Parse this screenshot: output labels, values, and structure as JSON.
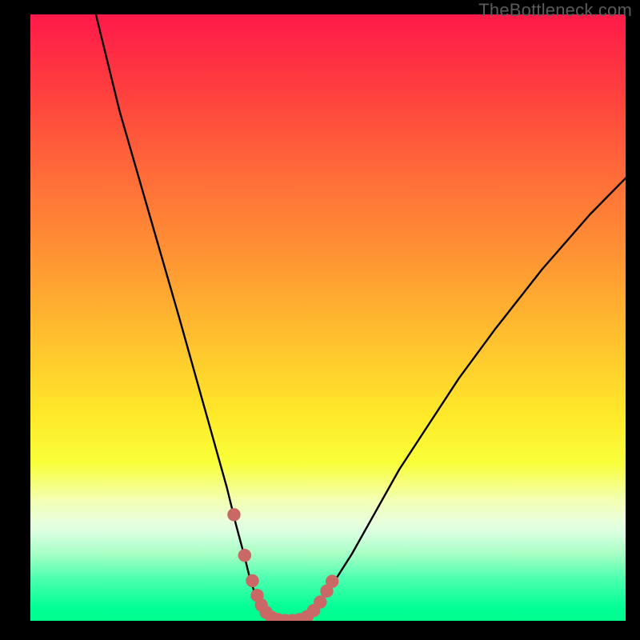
{
  "watermark": "TheBottleneck.com",
  "chart_data": {
    "type": "line",
    "title": "",
    "xlabel": "",
    "ylabel": "",
    "xlim": [
      0,
      100
    ],
    "ylim": [
      0,
      100
    ],
    "series": [
      {
        "name": "curve",
        "x": [
          11,
          15,
          20,
          25,
          27,
          29,
          31,
          33,
          34.5,
          36,
          37,
          38.3,
          39.5,
          41,
          43,
          45,
          47,
          49,
          51,
          54,
          58,
          62,
          66,
          72,
          78,
          86,
          94,
          100
        ],
        "values": [
          100,
          84,
          67,
          50,
          43,
          36,
          29,
          22,
          16,
          10.5,
          6.5,
          3.0,
          1.2,
          0.2,
          0.0,
          0.4,
          1.6,
          3.6,
          6.4,
          11,
          18,
          25,
          31,
          40,
          48,
          58,
          67,
          73
        ]
      }
    ],
    "markers": {
      "name": "highlight-dots",
      "x": [
        34.2,
        36.0,
        37.3,
        38.1,
        38.8,
        39.6,
        40.5,
        41.6,
        42.8,
        44.0,
        45.2,
        46.5,
        47.6,
        48.7,
        49.8,
        50.7
      ],
      "values": [
        17.5,
        10.8,
        6.6,
        4.2,
        2.6,
        1.4,
        0.6,
        0.2,
        0.05,
        0.05,
        0.2,
        0.7,
        1.7,
        3.1,
        4.9,
        6.5
      ]
    },
    "colors": {
      "curve": "#000000",
      "markers": "#c96864",
      "gradient_top": "#ff1a49",
      "gradient_bottom": "#00ff8c"
    }
  }
}
